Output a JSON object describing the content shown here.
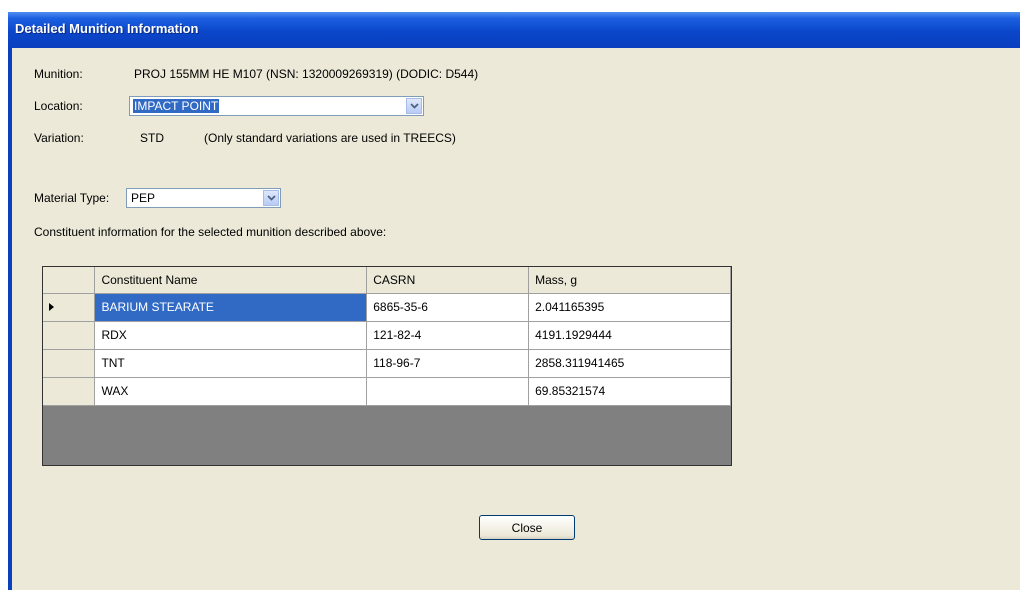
{
  "window": {
    "title": "Detailed Munition Information"
  },
  "munition": {
    "label": "Munition:",
    "value": "PROJ 155MM HE M107 (NSN: 1320009269319) (DODIC: D544)"
  },
  "location": {
    "label": "Location:",
    "value": "IMPACT POINT"
  },
  "variation": {
    "label": "Variation:",
    "value": "STD",
    "note": "(Only standard variations are used in TREECS)"
  },
  "material_type": {
    "label": "Material Type:",
    "value": "PEP"
  },
  "constituent_caption": "Constituent information for the selected munition described above:",
  "grid": {
    "columns": [
      "Constituent Name",
      "CASRN",
      "Mass, g"
    ],
    "rows": [
      {
        "name": "BARIUM STEARATE",
        "casrn": "6865-35-6",
        "mass": "2.041165395",
        "selected": true
      },
      {
        "name": "RDX",
        "casrn": "121-82-4",
        "mass": "4191.1929444"
      },
      {
        "name": "TNT",
        "casrn": "118-96-7",
        "mass": "2858.311941465"
      },
      {
        "name": "WAX",
        "casrn": "",
        "mass": "69.85321574"
      }
    ]
  },
  "buttons": {
    "close": "Close"
  },
  "icons": {
    "dropdown": "chevron-down-icon",
    "row_pointer": "row-pointer-icon"
  },
  "colors": {
    "title_bar": "#0a3fbf",
    "selection": "#316ac5",
    "dialog_bg": "#ece9d8"
  }
}
